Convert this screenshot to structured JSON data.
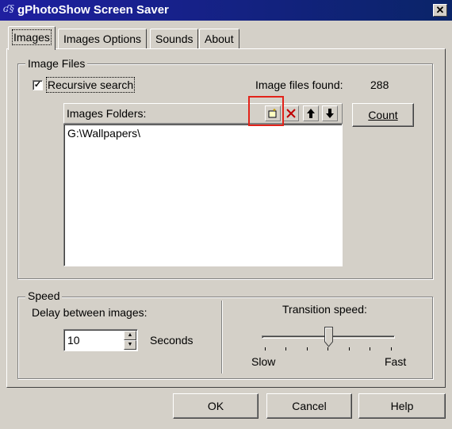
{
  "window": {
    "title": "gPhotoShow Screen Saver",
    "close_glyph": "✕"
  },
  "tabs": [
    {
      "label": "Images",
      "active": true
    },
    {
      "label": "Images Options"
    },
    {
      "label": "Sounds"
    },
    {
      "label": "About"
    }
  ],
  "image_files": {
    "legend": "Image Files",
    "recursive_label": "Recursive search",
    "recursive_checked": true,
    "found_label": "Image files found:",
    "found_count": "288",
    "folders_label": "Images Folders:",
    "folders": [
      "G:\\Wallpapers\\"
    ],
    "toolbar": {
      "add_icon": "add-folder-icon",
      "delete_icon": "delete-icon",
      "up_icon": "arrow-up-icon",
      "down_icon": "arrow-down-icon",
      "delete_color": "#c00000"
    },
    "count_button": "Count"
  },
  "speed": {
    "legend": "Speed",
    "delay_label": "Delay between images:",
    "delay_value": "10",
    "seconds_label": "Seconds",
    "transition_label": "Transition speed:",
    "transition_value": 0.5,
    "slow_label": "Slow",
    "fast_label": "Fast"
  },
  "footer": {
    "ok": "OK",
    "cancel": "Cancel",
    "help": "Help"
  },
  "colors": {
    "titlebar": "#1f1fa0",
    "highlight": "#e2231a",
    "face": "#d4d0c8"
  }
}
